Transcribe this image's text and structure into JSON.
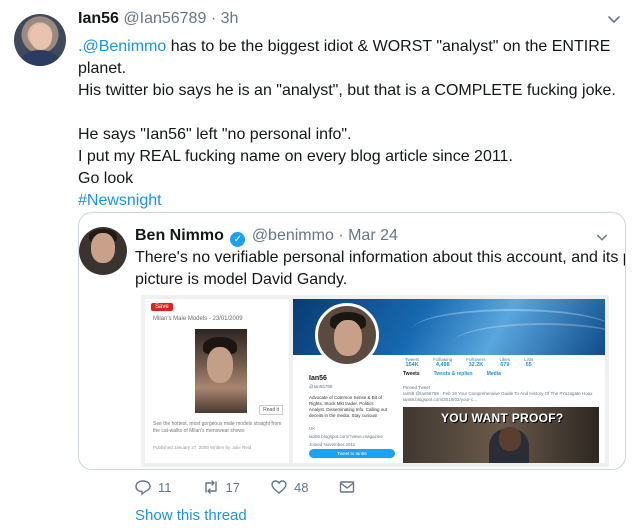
{
  "tweet": {
    "author_name": "Ian56",
    "author_handle": "@Ian56789",
    "separator": "·",
    "time": "3h",
    "lines": [
      ".@Benimmo has to be the biggest idiot & WORST \"analyst\" on the ENTIRE",
      "planet.",
      "His twitter bio says he is an \"analyst\", but that is a COMPLETE fucking joke."
    ],
    "mention": ".@Benimmo",
    "line1_rest": " has to be the biggest idiot & WORST \"analyst\" on the ENTIRE",
    "lines2": [
      "He says \"Ian56\" left \"no personal info\".",
      "I put my REAL fucking name on every blog article since 2011.",
      "Go look"
    ],
    "hashtag": "#Newsnight"
  },
  "quote": {
    "author_name": "Ben Nimmo",
    "author_handle": "@benimmo",
    "separator": "·",
    "time": "Mar 24",
    "lines": [
      "There's no verifiable personal information about this account, and its profile",
      "picture is model David Gandy."
    ],
    "image": {
      "save_badge": "Save",
      "left_title": "Milan's Male Models - 23/01/2009",
      "read_it": "Read it",
      "left_desc": "See the hottest, most gorgeous male models straight from the cat-walks of Milan's menswear shows",
      "left_meta": "Published January 27, 2009\nWritten by Julie Reid",
      "stats": [
        {
          "label": "Tweets",
          "value": "154K"
        },
        {
          "label": "Following",
          "value": "4,498"
        },
        {
          "label": "Followers",
          "value": "32.2K"
        },
        {
          "label": "Likes",
          "value": "679"
        },
        {
          "label": "Lists",
          "value": "55"
        }
      ],
      "profile_name": "Ian56",
      "profile_handle": "@Ian56789",
      "profile_bio": "Advocate of Common Sense & Bit of Rights. Stock Mkt trader. Politics Analyst. Disseminating Info. Calling out deceits in the media. Stay curious!",
      "profile_info": [
        "UK",
        "ian56.blogspot.com/?view=magazine",
        "Joined November 2011"
      ],
      "tweet_button": "Tweet to Ian56",
      "tab_tweets": "Tweets",
      "tab_replies": "Tweets & replies",
      "tab_media": "Media",
      "pinned_label": "Pinned Tweet",
      "pinned_text": "Ian56 @Ian56789 · Feb 19 Your Comprehensive Guide To And History Of The #Yuzagate Hoax ian56.blogspot.com/2018/02/your-c...",
      "meme_text": "YOU WANT PROOF?"
    }
  },
  "actions": {
    "reply_count": "11",
    "retweet_count": "17",
    "like_count": "48"
  },
  "show_thread": "Show this thread",
  "colors": {
    "link": "#1b95e0",
    "muted": "#657786",
    "text": "#14171a",
    "border": "#ccd6dd",
    "verified": "#1da1f2"
  }
}
